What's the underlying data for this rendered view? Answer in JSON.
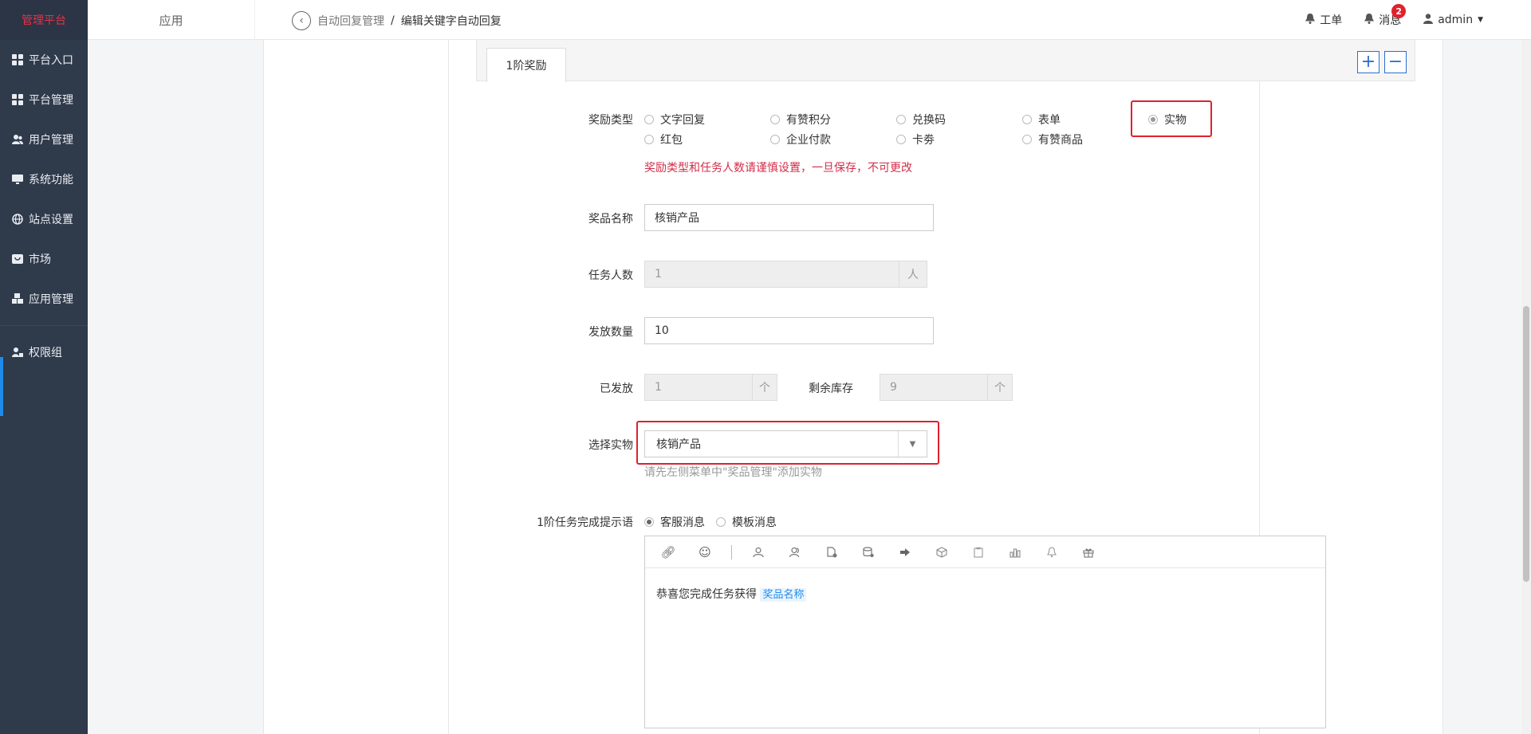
{
  "brand": "管理平台",
  "sidebar": {
    "items": [
      {
        "label": "平台入口",
        "icon": "grid-icon"
      },
      {
        "label": "平台管理",
        "icon": "grid-icon"
      },
      {
        "label": "用户管理",
        "icon": "users-icon"
      },
      {
        "label": "系统功能",
        "icon": "monitor-icon"
      },
      {
        "label": "站点设置",
        "icon": "globe-icon"
      },
      {
        "label": "市场",
        "icon": "store-icon"
      },
      {
        "label": "应用管理",
        "icon": "cubes-icon"
      },
      {
        "label": "权限组",
        "icon": "user-lock-icon"
      }
    ]
  },
  "header": {
    "app_tab": "应用",
    "breadcrumb": [
      "自动回复管理",
      "编辑关键字自动回复"
    ],
    "breadcrumb_sep": "/",
    "workorder": "工单",
    "messages": "消息",
    "message_count": "2",
    "user": "admin"
  },
  "tabs": {
    "reward_tab": "1阶奖励",
    "add": "+",
    "remove": "−"
  },
  "form": {
    "reward_type_label": "奖励类型",
    "reward_types": [
      {
        "label": "文字回复",
        "selected": false
      },
      {
        "label": "有赞积分",
        "selected": false
      },
      {
        "label": "兑换码",
        "selected": false
      },
      {
        "label": "表单",
        "selected": false
      },
      {
        "label": "实物",
        "selected": true
      },
      {
        "label": "红包",
        "selected": false
      },
      {
        "label": "企业付款",
        "selected": false
      },
      {
        "label": "卡劵",
        "selected": false
      },
      {
        "label": "有赞商品",
        "selected": false
      }
    ],
    "warning": "奖励类型和任务人数请谨慎设置，一旦保存，不可更改",
    "prize_name_label": "奖品名称",
    "prize_name_value": "核销产品",
    "task_count_label": "任务人数",
    "task_count_value": "1",
    "task_count_unit": "人",
    "issue_count_label": "发放数量",
    "issue_count_value": "10",
    "issued_label": "已发放",
    "issued_value": "1",
    "issued_unit": "个",
    "stock_label": "剩余库存",
    "stock_value": "9",
    "stock_unit": "个",
    "item_label": "选择实物",
    "item_value": "核销产品",
    "item_help": "请先左侧菜单中\"奖品管理\"添加实物",
    "prompt_label": "1阶任务完成提示语",
    "prompt_types": [
      {
        "label": "客服消息",
        "selected": true
      },
      {
        "label": "模板消息",
        "selected": false
      }
    ],
    "editor_text": "恭喜您完成任务获得",
    "editor_tag": "奖品名称"
  },
  "colors": {
    "sidebar_bg": "#2f3a4b",
    "brand_red": "#e0334a",
    "highlight_red": "#e0212e",
    "accent_blue": "#2b6fd2",
    "warning": "#d22e48"
  }
}
